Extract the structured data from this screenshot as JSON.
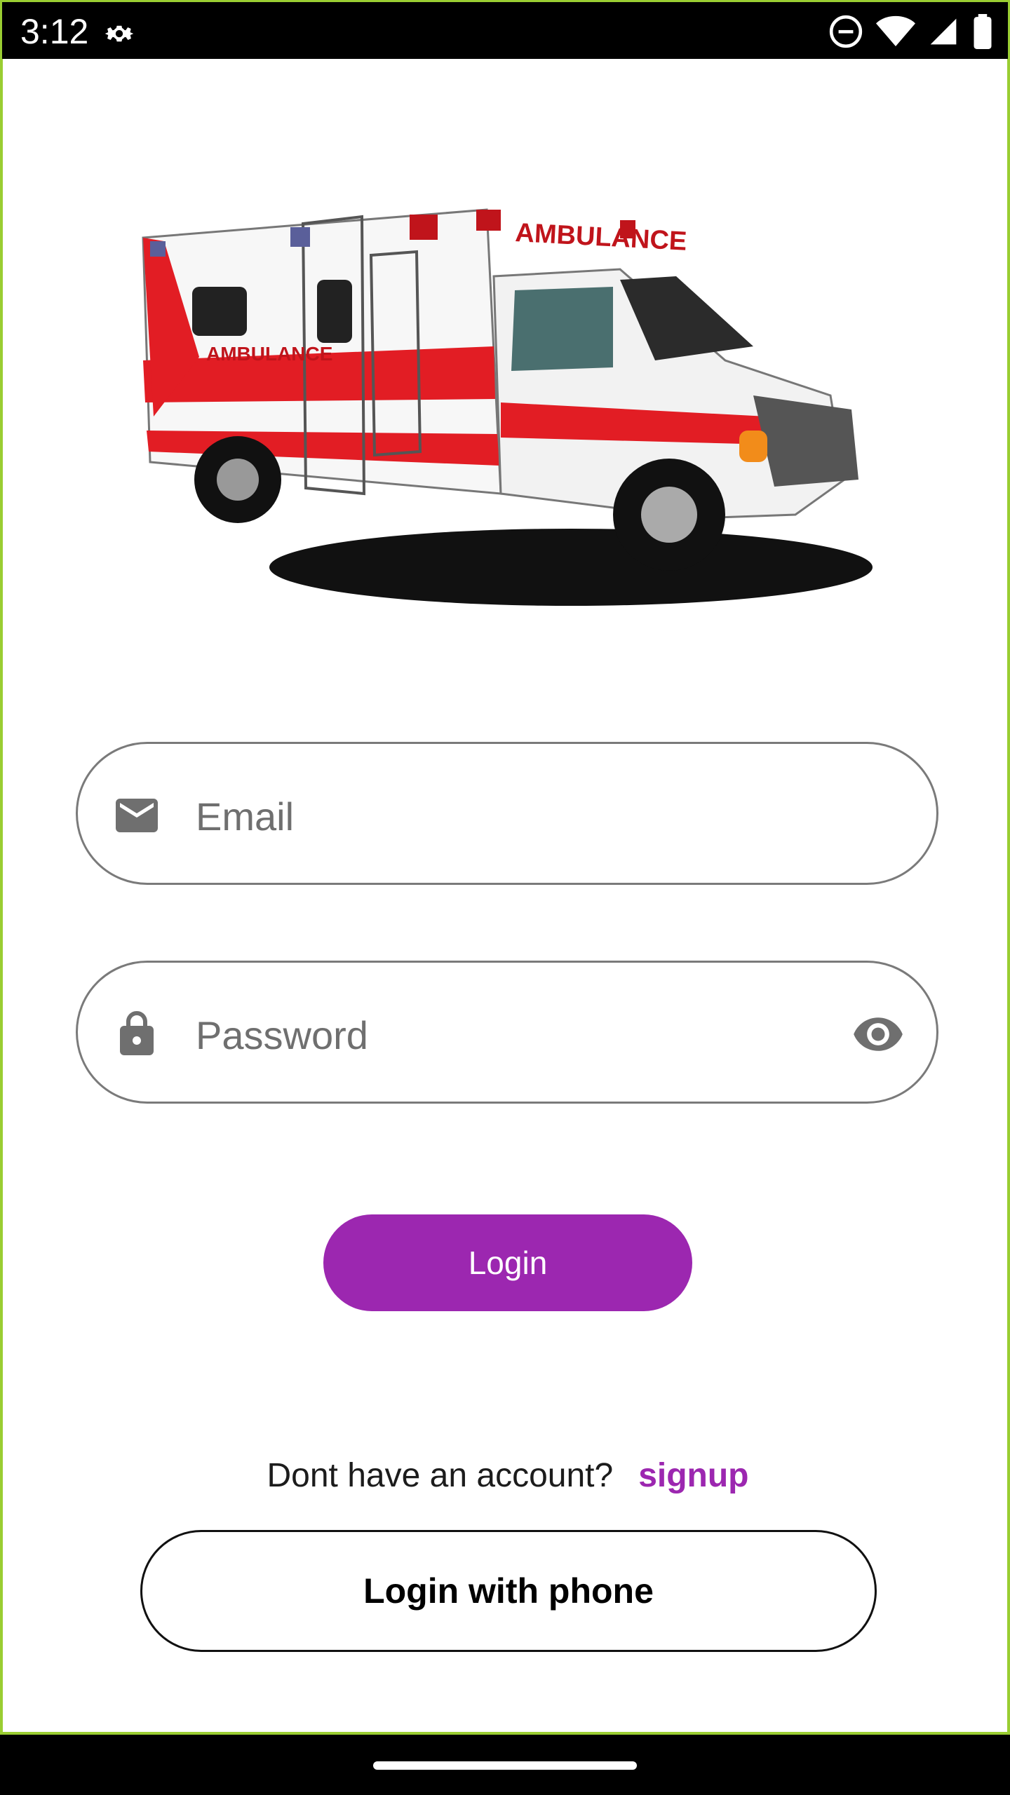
{
  "status_bar": {
    "time": "3:12"
  },
  "hero": {
    "image_label": "AMBULANCE"
  },
  "email_field": {
    "placeholder": "Email",
    "icon": "mail-icon"
  },
  "password_field": {
    "placeholder": "Password",
    "icon": "lock-icon",
    "toggle_icon": "eye-icon"
  },
  "login_button": {
    "label": "Login"
  },
  "signup": {
    "prompt": "Dont have an account?",
    "link": "signup"
  },
  "phone_button": {
    "label": "Login with phone"
  },
  "colors": {
    "accent": "#9c27b0",
    "border": "#7a7a7a",
    "status_bar": "#000000",
    "frame": "#9acd32"
  }
}
